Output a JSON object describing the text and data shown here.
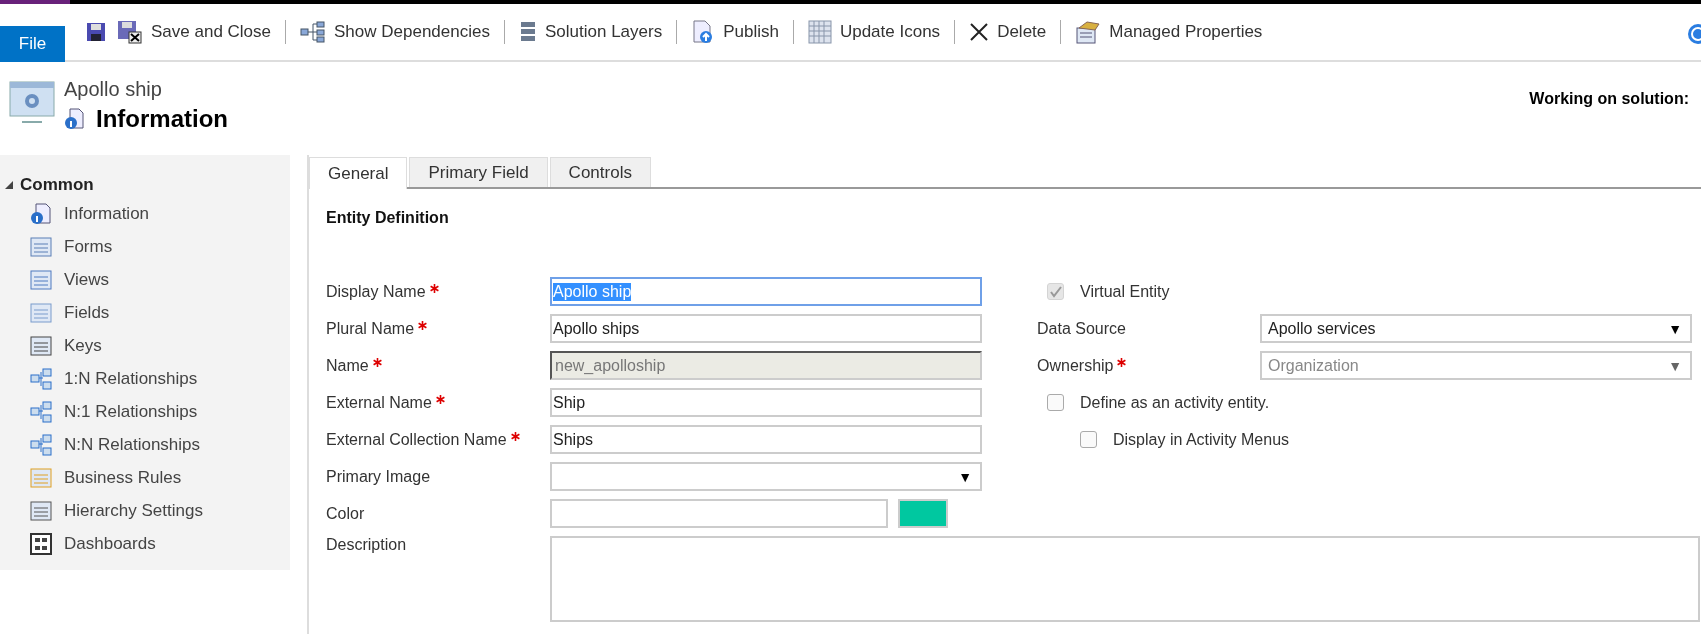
{
  "toolbar": {
    "file": "File",
    "groups": [
      [
        {
          "kind": "icon"
        },
        {
          "kind": "labeled",
          "label": "Save and Close"
        }
      ],
      [
        {
          "label": "Show Dependencies"
        }
      ],
      [
        {
          "label": "Solution Layers"
        }
      ],
      [
        {
          "label": "Publish"
        }
      ],
      [
        {
          "label": "Update Icons"
        }
      ],
      [
        {
          "label": "Delete"
        }
      ],
      [
        {
          "label": "Managed Properties"
        }
      ]
    ]
  },
  "header": {
    "entity": "Apollo ship",
    "page": "Information",
    "solution": "Working on solution:"
  },
  "sidebar": {
    "section": "Common",
    "expanded": true,
    "items": [
      {
        "label": "Information"
      },
      {
        "label": "Forms"
      },
      {
        "label": "Views"
      },
      {
        "label": "Fields"
      },
      {
        "label": "Keys"
      },
      {
        "label": "1:N Relationships"
      },
      {
        "label": "N:1 Relationships"
      },
      {
        "label": "N:N Relationships"
      },
      {
        "label": "Business Rules"
      },
      {
        "label": "Hierarchy Settings"
      },
      {
        "label": "Dashboards"
      }
    ]
  },
  "tabs": [
    {
      "label": "General",
      "selected": true
    },
    {
      "label": "Primary Field",
      "selected": false
    },
    {
      "label": "Controls",
      "selected": false
    }
  ],
  "section_title": "Entity Definition",
  "left_fields": [
    {
      "kind": "text",
      "label": "Display Name",
      "required": true,
      "value": "Apollo ship",
      "focused": true
    },
    {
      "kind": "text",
      "label": "Plural Name",
      "required": true,
      "value": "Apollo ships",
      "focused": false
    },
    {
      "kind": "readonly",
      "label": "Name",
      "required": true,
      "value": "new_apolloship"
    },
    {
      "kind": "text",
      "label": "External Name",
      "required": true,
      "value": "Ship",
      "focused": false
    },
    {
      "kind": "text",
      "label": "External Collection Name",
      "required": true,
      "value": "Ships",
      "focused": false
    },
    {
      "kind": "select",
      "label": "Primary Image",
      "required": false,
      "disabled": false,
      "arrow": "▼"
    },
    {
      "kind": "color",
      "label": "Color",
      "required": false,
      "color": "#00c8a0"
    }
  ],
  "right_fields": [
    {
      "kind": "checkbox",
      "label": "Virtual Entity",
      "checked": true,
      "disabled": true
    },
    {
      "kind": "select",
      "label": "Data Source",
      "required": false,
      "value": "Apollo services",
      "disabled": false,
      "arrow": "▼"
    },
    {
      "kind": "select",
      "label": "Ownership",
      "required": true,
      "value": "Organization",
      "disabled": true,
      "arrow": "▼"
    },
    {
      "kind": "checkbox",
      "label": "Define as an activity entity.",
      "checked": false,
      "disabled": false,
      "children": [
        {
          "kind": "checkbox",
          "label": "Display in Activity Menus",
          "checked": false,
          "disabled": false
        }
      ]
    }
  ],
  "description": {
    "label": "Description"
  }
}
